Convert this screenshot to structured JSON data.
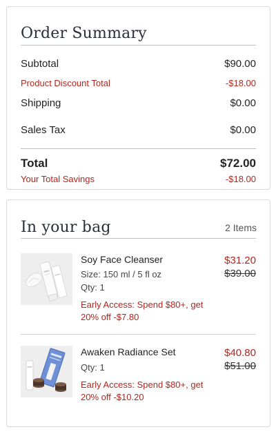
{
  "summary": {
    "title": "Order Summary",
    "subtotal_label": "Subtotal",
    "subtotal_value": "$90.00",
    "discount_label": "Product Discount Total",
    "discount_value": "-$18.00",
    "shipping_label": "Shipping",
    "shipping_value": "$0.00",
    "tax_label": "Sales Tax",
    "tax_value": "$0.00",
    "total_label": "Total",
    "total_value": "$72.00",
    "savings_label": "Your Total Savings",
    "savings_value": "-$18.00"
  },
  "bag": {
    "title": "In your bag",
    "count": "2 Items",
    "items": [
      {
        "name": "Soy Face Cleanser",
        "size": "Size: 150 ml / 5 fl oz",
        "qty": "Qty: 1",
        "promo": "Early Access: Spend $80+, get 20% off -$7.80",
        "price": "$31.20",
        "original_price": "$39.00",
        "image": "cleanser-tube-with-product-smear"
      },
      {
        "name": "Awaken Radiance Set",
        "qty": "Qty: 1",
        "promo": "Early Access: Spend $80+, get 20% off -$10.20",
        "price": "$40.80",
        "original_price": "$51.00",
        "image": "radiance-set-box-tube-and-jars"
      }
    ]
  },
  "colors": {
    "accent_red": "#b3261e",
    "title_navy": "#2b2f3a",
    "border": "#d9d9d9"
  }
}
